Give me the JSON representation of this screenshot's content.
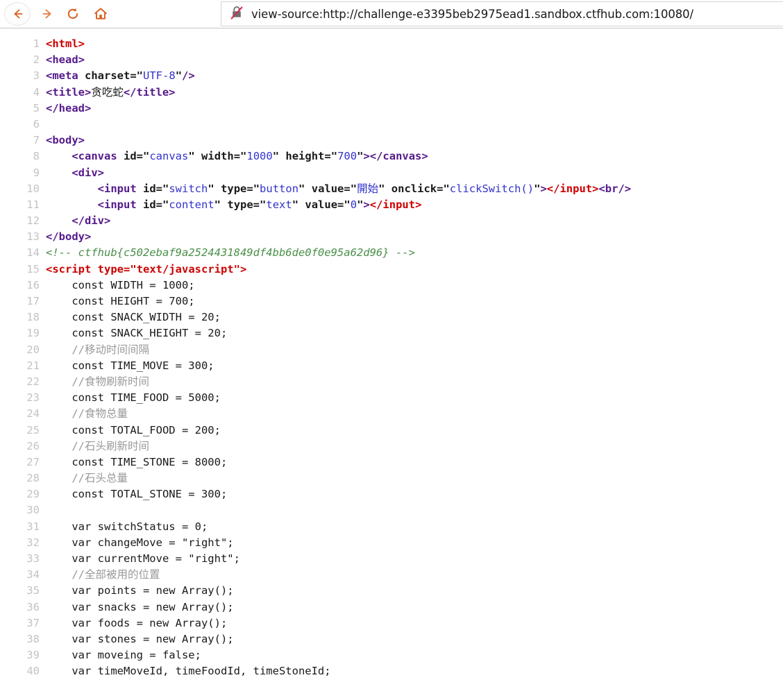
{
  "browser": {
    "nav": {
      "back_label": "Back",
      "forward_label": "Forward",
      "reload_label": "Reload",
      "home_label": "Home"
    },
    "address_bar": {
      "url": "view-source:http://challenge-e3395beb2975ead1.sandbox.ctfhub.com:10080/",
      "security_icon": "padlock-crossed-insecure-icon",
      "security_state": "Not secure"
    },
    "colors": {
      "toolbar_icon": "#d9601f",
      "toolbar_border": "#c6c6c6",
      "url_border": "#d4d4d4",
      "lock_slash": "#d62d4e"
    }
  },
  "source": {
    "flag": "ctfhub{c502ebaf9a2524431849df4bb6de0f0e95a62d96}",
    "page_title": "贪吃蛇",
    "syntax_colors": {
      "tag_red": "#cc0000",
      "tag_purple": "#551a8b",
      "attr_value": "#3333cc",
      "html_comment": "#4a8f4a",
      "js_comment": "#999999",
      "line_number": "#c3c3c3"
    },
    "lines": [
      {
        "n": "1",
        "html": "<span class=\"t-red\">&lt;html&gt;</span>"
      },
      {
        "n": "2",
        "html": "<span class=\"t-purple\">&lt;head&gt;</span>"
      },
      {
        "n": "3",
        "html": "<span class=\"t-purple\">&lt;meta</span> <span class=\"t-attr\">charset=</span><span class=\"t-punct\">&quot;</span><span class=\"t-val\">UTF-8</span><span class=\"t-punct\">&quot;</span><span class=\"t-purple\">/&gt;</span>"
      },
      {
        "n": "4",
        "html": "<span class=\"t-purple\">&lt;title&gt;</span><span class=\"t-plain\">贪吃蛇</span><span class=\"t-purple\">&lt;/title&gt;</span>"
      },
      {
        "n": "5",
        "html": "<span class=\"t-purple\">&lt;/head&gt;</span>"
      },
      {
        "n": "6",
        "html": ""
      },
      {
        "n": "7",
        "html": "<span class=\"t-purple\">&lt;body&gt;</span>"
      },
      {
        "n": "8",
        "html": "    <span class=\"t-purple\">&lt;canvas</span> <span class=\"t-attr\">id=</span><span class=\"t-punct\">&quot;</span><span class=\"t-val\">canvas</span><span class=\"t-punct\">&quot;</span> <span class=\"t-attr\">width=</span><span class=\"t-punct\">&quot;</span><span class=\"t-val\">1000</span><span class=\"t-punct\">&quot;</span> <span class=\"t-attr\">height=</span><span class=\"t-punct\">&quot;</span><span class=\"t-val\">700</span><span class=\"t-punct\">&quot;</span><span class=\"t-purple\">&gt;&lt;/canvas&gt;</span>"
      },
      {
        "n": "9",
        "html": "    <span class=\"t-purple\">&lt;div&gt;</span>"
      },
      {
        "n": "10",
        "html": "        <span class=\"t-purple\">&lt;input</span> <span class=\"t-attr\">id=</span><span class=\"t-punct\">&quot;</span><span class=\"t-val\">switch</span><span class=\"t-punct\">&quot;</span> <span class=\"t-attr\">type=</span><span class=\"t-punct\">&quot;</span><span class=\"t-val\">button</span><span class=\"t-punct\">&quot;</span> <span class=\"t-attr\">value=</span><span class=\"t-punct\">&quot;</span><span class=\"t-val\">開始</span><span class=\"t-punct\">&quot;</span> <span class=\"t-attr\">onclick=</span><span class=\"t-punct\">&quot;</span><span class=\"t-val\">clickSwitch()</span><span class=\"t-punct\">&quot;</span><span class=\"t-purple\">&gt;</span><span class=\"t-red\">&lt;/input&gt;</span><span class=\"t-purple\">&lt;br/&gt;</span>"
      },
      {
        "n": "11",
        "html": "        <span class=\"t-purple\">&lt;input</span> <span class=\"t-attr\">id=</span><span class=\"t-punct\">&quot;</span><span class=\"t-val\">content</span><span class=\"t-punct\">&quot;</span> <span class=\"t-attr\">type=</span><span class=\"t-punct\">&quot;</span><span class=\"t-val\">text</span><span class=\"t-punct\">&quot;</span> <span class=\"t-attr\">value=</span><span class=\"t-punct\">&quot;</span><span class=\"t-val\">0</span><span class=\"t-punct\">&quot;</span><span class=\"t-purple\">&gt;</span><span class=\"t-red\">&lt;/input&gt;</span>"
      },
      {
        "n": "12",
        "html": "    <span class=\"t-purple\">&lt;/div&gt;</span>"
      },
      {
        "n": "13",
        "html": "<span class=\"t-purple\">&lt;/body&gt;</span>"
      },
      {
        "n": "14",
        "html": "<span class=\"t-comment\">&lt;!-- ctfhub{c502ebaf9a2524431849df4bb6de0f0e95a62d96} --&gt;</span>"
      },
      {
        "n": "15",
        "html": "<span class=\"t-red\">&lt;script</span> <span class=\"t-red\">type=</span><span class=\"t-red\">&quot;</span><span class=\"t-red\">text/javascript</span><span class=\"t-red\">&quot;</span><span class=\"t-red\">&gt;</span>"
      },
      {
        "n": "16",
        "html": "    <span class=\"t-plain\">const WIDTH = 1000;</span>"
      },
      {
        "n": "17",
        "html": "    <span class=\"t-plain\">const HEIGHT = 700;</span>"
      },
      {
        "n": "18",
        "html": "    <span class=\"t-plain\">const SNACK_WIDTH = 20;</span>"
      },
      {
        "n": "19",
        "html": "    <span class=\"t-plain\">const SNACK_HEIGHT = 20;</span>"
      },
      {
        "n": "20",
        "html": "    <span class=\"t-jscomment\">//移动时间间隔</span>"
      },
      {
        "n": "21",
        "html": "    <span class=\"t-plain\">const TIME_MOVE = 300;</span>"
      },
      {
        "n": "22",
        "html": "    <span class=\"t-jscomment\">//食物刷新时间</span>"
      },
      {
        "n": "23",
        "html": "    <span class=\"t-plain\">const TIME_FOOD = 5000;</span>"
      },
      {
        "n": "24",
        "html": "    <span class=\"t-jscomment\">//食物总量</span>"
      },
      {
        "n": "25",
        "html": "    <span class=\"t-plain\">const TOTAL_FOOD = 200;</span>"
      },
      {
        "n": "26",
        "html": "    <span class=\"t-jscomment\">//石头刷新时间</span>"
      },
      {
        "n": "27",
        "html": "    <span class=\"t-plain\">const TIME_STONE = 8000;</span>"
      },
      {
        "n": "28",
        "html": "    <span class=\"t-jscomment\">//石头总量</span>"
      },
      {
        "n": "29",
        "html": "    <span class=\"t-plain\">const TOTAL_STONE = 300;</span>"
      },
      {
        "n": "30",
        "html": ""
      },
      {
        "n": "31",
        "html": "    <span class=\"t-plain\">var switchStatus = 0;</span>"
      },
      {
        "n": "32",
        "html": "    <span class=\"t-plain\">var changeMove = &quot;right&quot;;</span>"
      },
      {
        "n": "33",
        "html": "    <span class=\"t-plain\">var currentMove = &quot;right&quot;;</span>"
      },
      {
        "n": "34",
        "html": "    <span class=\"t-jscomment\">//全部被用的位置</span>"
      },
      {
        "n": "35",
        "html": "    <span class=\"t-plain\">var points = new Array();</span>"
      },
      {
        "n": "36",
        "html": "    <span class=\"t-plain\">var snacks = new Array();</span>"
      },
      {
        "n": "37",
        "html": "    <span class=\"t-plain\">var foods = new Array();</span>"
      },
      {
        "n": "38",
        "html": "    <span class=\"t-plain\">var stones = new Array();</span>"
      },
      {
        "n": "39",
        "html": "    <span class=\"t-plain\">var moveing = false;</span>"
      },
      {
        "n": "40",
        "html": "    <span class=\"t-plain\">var timeMoveId, timeFoodId, timeStoneId;</span>"
      }
    ]
  }
}
